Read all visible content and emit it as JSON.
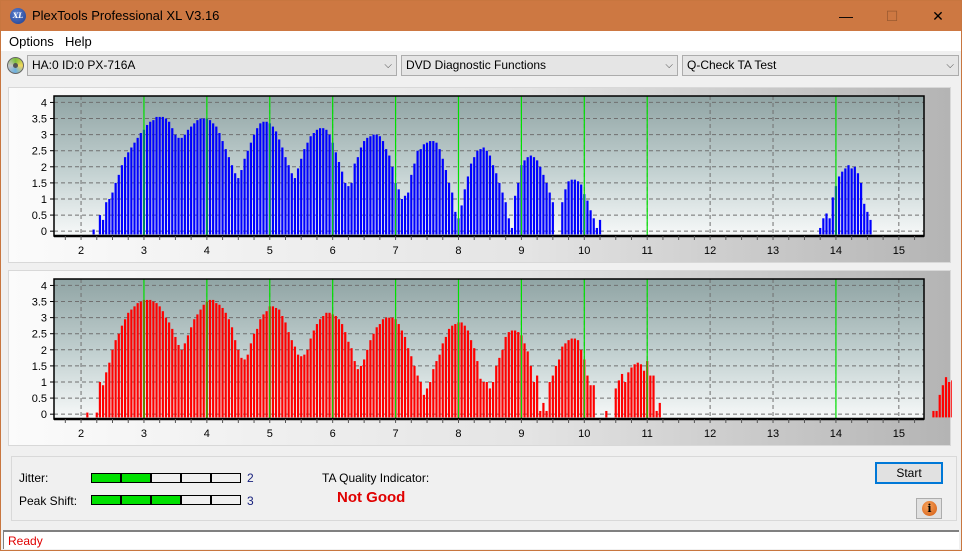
{
  "window": {
    "title": "PlexTools Professional XL V3.16",
    "app_icon_text": "XL",
    "controls": {
      "minimize": "—",
      "maximize": "☐",
      "close": "✕"
    }
  },
  "menu": {
    "items": [
      "Options",
      "Help"
    ]
  },
  "toolbar": {
    "drive": "HA:0 ID:0  PX-716A",
    "function": "DVD Diagnostic Functions",
    "test": "Q-Check TA Test",
    "chevron": "⌵"
  },
  "chart_data": [
    {
      "type": "bar",
      "name": "ta-chart-inner",
      "color": "#0000ff",
      "x_start": 2.0,
      "x_step": 0.05,
      "xlim": [
        1.57,
        15.4
      ],
      "ylim": [
        -0.15,
        4.2
      ],
      "xticks": [
        2,
        3,
        4,
        5,
        6,
        7,
        8,
        9,
        10,
        11,
        12,
        13,
        14,
        15
      ],
      "yticks": [
        0,
        0.5,
        1,
        1.5,
        2,
        2.5,
        3,
        3.5,
        4
      ],
      "ytick_labels": [
        "0",
        "0.5",
        "1",
        "1.5",
        "2",
        "2.5",
        "3",
        "3.5",
        "4"
      ],
      "reference_lines": [
        3,
        4,
        5,
        6,
        7,
        8,
        9,
        10,
        11,
        14
      ],
      "grid": true,
      "values": [
        0,
        0,
        0,
        0,
        0.05,
        0,
        0.5,
        0.35,
        0.9,
        1.0,
        1.2,
        1.5,
        1.75,
        2.05,
        2.3,
        2.45,
        2.6,
        2.75,
        2.9,
        3.05,
        3.15,
        3.3,
        3.4,
        3.45,
        3.55,
        3.55,
        3.55,
        3.5,
        3.4,
        3.2,
        3.0,
        2.9,
        2.9,
        3.0,
        3.15,
        3.25,
        3.35,
        3.45,
        3.5,
        3.5,
        3.5,
        3.45,
        3.35,
        3.25,
        3.05,
        2.8,
        2.55,
        2.3,
        2.05,
        1.8,
        1.65,
        1.9,
        2.25,
        2.5,
        2.75,
        3.0,
        3.2,
        3.35,
        3.4,
        3.4,
        3.35,
        3.25,
        3.1,
        2.85,
        2.6,
        2.3,
        2.05,
        1.8,
        1.65,
        1.95,
        2.25,
        2.55,
        2.75,
        2.95,
        3.05,
        3.15,
        3.2,
        3.2,
        3.15,
        3.0,
        2.75,
        2.45,
        2.15,
        1.85,
        1.5,
        1.4,
        1.5,
        2.1,
        2.3,
        2.6,
        2.8,
        2.9,
        2.95,
        3.0,
        3.0,
        2.95,
        2.8,
        2.55,
        2.35,
        2.0,
        1.5,
        1.3,
        1.0,
        1.1,
        1.2,
        1.75,
        2.1,
        2.5,
        2.55,
        2.7,
        2.75,
        2.8,
        2.8,
        2.75,
        2.55,
        2.25,
        1.9,
        1.5,
        1.2,
        0.6,
        0.4,
        0.8,
        1.3,
        1.7,
        2.1,
        2.3,
        2.5,
        2.55,
        2.6,
        2.5,
        2.35,
        2.05,
        1.8,
        1.5,
        1.2,
        0.9,
        0.4,
        0.1,
        1.1,
        1.5,
        2.05,
        2.2,
        2.3,
        2.35,
        2.3,
        2.2,
        2.0,
        1.75,
        1.5,
        1.2,
        0.9,
        0,
        0,
        0.9,
        1.3,
        1.55,
        1.6,
        1.6,
        1.55,
        1.45,
        1.15,
        0.95,
        0.65,
        0.4,
        0.1,
        0.35,
        0,
        0,
        0,
        0,
        0,
        0,
        0,
        0,
        0,
        0,
        0,
        0,
        0,
        0,
        0,
        0,
        0,
        0,
        0,
        0,
        0,
        0,
        0,
        0,
        0,
        0,
        0,
        0,
        0,
        0,
        0,
        0,
        0,
        0,
        0,
        0,
        0,
        0,
        0,
        0,
        0,
        0,
        0,
        0,
        0,
        0,
        0,
        0,
        0,
        0,
        0,
        0,
        0,
        0,
        0,
        0,
        0,
        0,
        0,
        0,
        0,
        0,
        0,
        0,
        0,
        0,
        0,
        0,
        0,
        0.1,
        0.4,
        0.55,
        0.4,
        1.05,
        1.4,
        1.7,
        1.85,
        1.95,
        2.05,
        1.95,
        2.0,
        1.8,
        1.5,
        0.85,
        0.6,
        0.35
      ]
    },
    {
      "type": "bar",
      "name": "ta-chart-outer",
      "color": "#ff0000",
      "x_start": 2.0,
      "x_step": 0.05,
      "xlim": [
        1.57,
        15.4
      ],
      "ylim": [
        -0.15,
        4.2
      ],
      "xticks": [
        2,
        3,
        4,
        5,
        6,
        7,
        8,
        9,
        10,
        11,
        12,
        13,
        14,
        15
      ],
      "yticks": [
        0,
        0.5,
        1,
        1.5,
        2,
        2.5,
        3,
        3.5,
        4
      ],
      "ytick_labels": [
        "0",
        "0.5",
        "1",
        "1.5",
        "2",
        "2.5",
        "3",
        "3.5",
        "4"
      ],
      "reference_lines": [
        3,
        4,
        5,
        6,
        7,
        8,
        9,
        10,
        11,
        14
      ],
      "grid": true,
      "values": [
        0,
        0,
        0.05,
        0,
        0,
        0.05,
        1.0,
        0.9,
        1.3,
        1.6,
        2.0,
        2.3,
        2.5,
        2.75,
        2.95,
        3.15,
        3.25,
        3.35,
        3.45,
        3.5,
        3.55,
        3.55,
        3.55,
        3.5,
        3.45,
        3.35,
        3.2,
        3.0,
        2.85,
        2.65,
        2.4,
        2.15,
        2.0,
        2.2,
        2.45,
        2.7,
        2.95,
        3.1,
        3.25,
        3.4,
        3.5,
        3.55,
        3.55,
        3.45,
        3.4,
        3.3,
        3.15,
        2.95,
        2.7,
        2.3,
        2.0,
        1.75,
        1.7,
        1.85,
        2.2,
        2.5,
        2.65,
        2.95,
        3.1,
        3.2,
        3.35,
        3.35,
        3.3,
        3.25,
        3.05,
        2.85,
        2.55,
        2.3,
        2.1,
        1.85,
        1.8,
        1.85,
        2.0,
        2.35,
        2.6,
        2.8,
        2.95,
        3.05,
        3.15,
        3.15,
        3.1,
        3.05,
        2.95,
        2.8,
        2.55,
        2.25,
        2.05,
        1.65,
        1.4,
        1.5,
        1.7,
        2.0,
        2.3,
        2.5,
        2.7,
        2.8,
        2.95,
        3.0,
        3.0,
        3.0,
        2.95,
        2.8,
        2.6,
        2.4,
        2.05,
        1.8,
        1.5,
        1.2,
        1.0,
        0.6,
        0.8,
        1.0,
        1.4,
        1.65,
        1.85,
        2.2,
        2.4,
        2.65,
        2.75,
        2.8,
        2.85,
        2.85,
        2.75,
        2.6,
        2.3,
        2.05,
        1.65,
        1.1,
        1.0,
        1.0,
        0.8,
        1.0,
        1.5,
        1.75,
        2.0,
        2.4,
        2.55,
        2.6,
        2.6,
        2.55,
        2.45,
        2.2,
        1.95,
        1.5,
        1.0,
        1.2,
        0.1,
        0.35,
        0.1,
        1.0,
        1.2,
        1.5,
        1.7,
        2.1,
        2.2,
        2.3,
        2.35,
        2.35,
        2.3,
        2.0,
        1.7,
        1.2,
        0.9,
        0.9,
        0,
        0,
        0,
        0.1,
        0,
        0,
        0.8,
        1.05,
        1.25,
        1.0,
        1.3,
        1.45,
        1.55,
        1.6,
        1.55,
        1.35,
        1.65,
        1.2,
        1.2,
        0.1,
        0.35,
        0,
        0,
        0,
        0,
        0,
        0,
        0,
        0,
        0,
        0,
        0,
        0,
        0,
        0,
        0,
        0,
        0,
        0,
        0,
        0,
        0,
        0,
        0,
        0,
        0,
        0,
        0,
        0,
        0,
        0,
        0,
        0,
        0,
        0,
        0,
        0,
        0,
        0,
        0,
        0,
        0,
        0,
        0,
        0,
        0,
        0,
        0,
        0,
        0,
        0,
        0,
        0,
        0,
        0,
        0,
        0,
        0,
        0,
        0,
        0,
        0,
        0,
        0,
        0,
        0,
        0,
        0,
        0,
        0,
        0,
        0,
        0,
        0,
        0,
        0,
        0,
        0,
        0,
        0,
        0,
        0,
        0,
        0,
        0,
        0,
        0,
        0.1,
        0.1,
        0.6,
        0.9,
        1.15,
        1.0,
        1.05,
        1.15,
        1.15,
        0.9,
        0.5,
        0.1
      ]
    }
  ],
  "results": {
    "jitter_label": "Jitter:",
    "jitter_value": "2",
    "jitter_level": 2,
    "peak_shift_label": "Peak Shift:",
    "peak_shift_value": "3",
    "peak_shift_level": 3,
    "meter_segments": 5,
    "ta_quality_label": "TA Quality Indicator:",
    "ta_quality_value": "Not Good",
    "start_label": "Start",
    "info_icon": "i"
  },
  "status": {
    "text": "Ready"
  },
  "colors": {
    "titlebar": "#cd7842",
    "meter_on": "#00e000",
    "ref_line": "#00e000",
    "status_text": "#e00000"
  }
}
